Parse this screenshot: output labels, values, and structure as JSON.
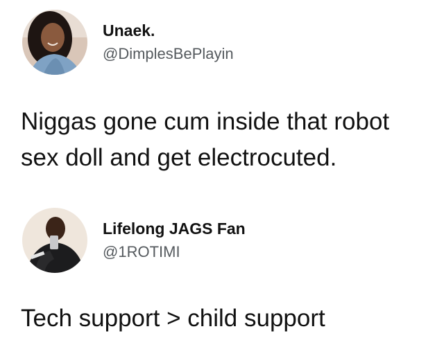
{
  "tweets": [
    {
      "display_name": "Unaek.",
      "handle": "@DimplesBePlayin",
      "text": "Niggas gone cum inside that robot\nsex doll and get electrocuted.",
      "avatar_icon": "profile-photo-icon"
    },
    {
      "display_name": "Lifelong JAGS Fan",
      "handle": "@1ROTIMI",
      "text": "Tech support > child support",
      "avatar_icon": "profile-photo-icon"
    }
  ],
  "colors": {
    "background": "#ffffff",
    "text": "#111111",
    "handle": "#555a5e"
  }
}
